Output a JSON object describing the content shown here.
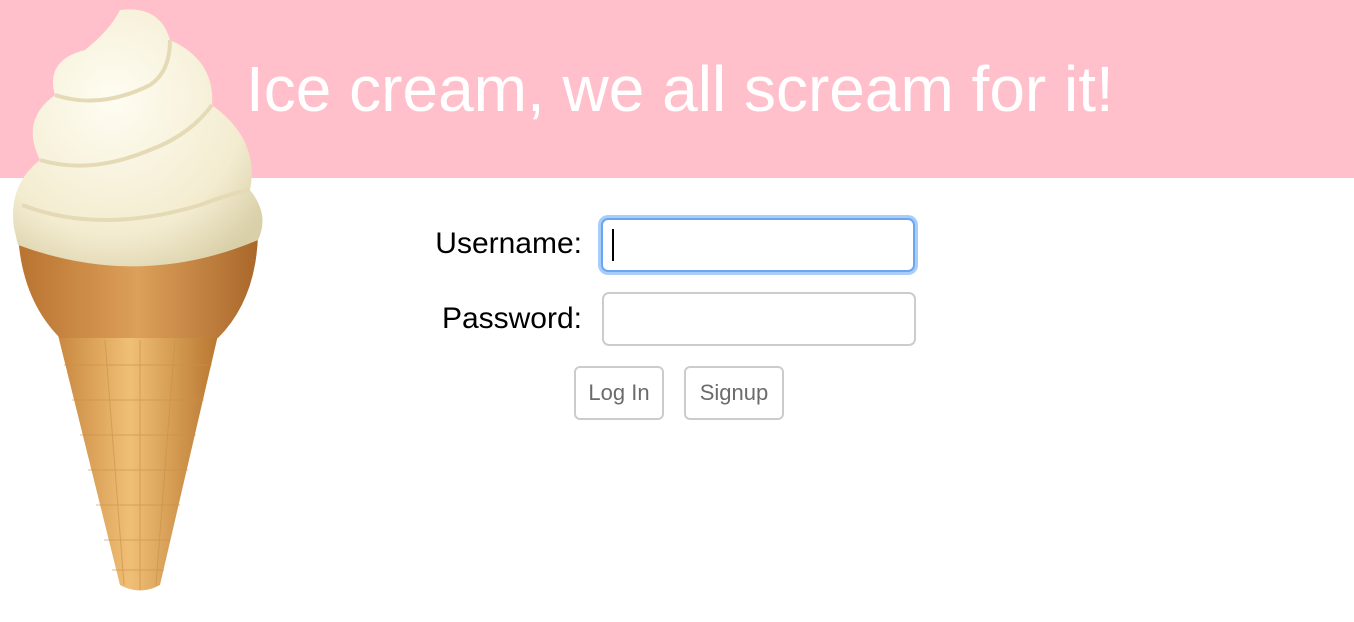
{
  "header": {
    "title": "Ice cream, we all scream for it!",
    "background_color": "#ffc0cb",
    "title_color": "#ffffff"
  },
  "illustration": {
    "icon": "ice-cream-cone-icon"
  },
  "login_form": {
    "username": {
      "label": "Username:",
      "value": "",
      "focused": true
    },
    "password": {
      "label": "Password:",
      "value": ""
    },
    "login_button_label": "Log In",
    "signup_button_label": "Signup",
    "focus_color": "#6aa7f0"
  }
}
